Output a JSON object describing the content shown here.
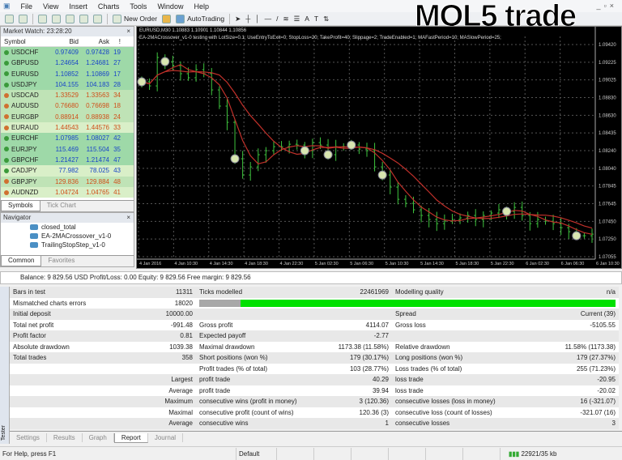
{
  "menu": [
    "File",
    "View",
    "Insert",
    "Charts",
    "Tools",
    "Window",
    "Help"
  ],
  "toolbar": {
    "new_order": "New Order",
    "autotrading": "AutoTrading"
  },
  "watermark": "MQL5 trade",
  "market_watch": {
    "title": "Market Watch: 23:28:20",
    "headers": [
      "Symbol",
      "Bid",
      "Ask",
      "!"
    ],
    "rows": [
      {
        "symbol": "USDCHF",
        "bid": "0.97409",
        "ask": "0.97428",
        "spread": "19",
        "dir": "up",
        "hl": true
      },
      {
        "symbol": "GBPUSD",
        "bid": "1.24654",
        "ask": "1.24681",
        "spread": "27",
        "dir": "up",
        "hl": true
      },
      {
        "symbol": "EURUSD",
        "bid": "1.10852",
        "ask": "1.10869",
        "spread": "17",
        "dir": "up",
        "hl": true
      },
      {
        "symbol": "USDJPY",
        "bid": "104.155",
        "ask": "104.183",
        "spread": "28",
        "dir": "up",
        "hl": true
      },
      {
        "symbol": "USDCAD",
        "bid": "1.33529",
        "ask": "1.33563",
        "spread": "34",
        "dir": "down",
        "hl": true
      },
      {
        "symbol": "AUDUSD",
        "bid": "0.76680",
        "ask": "0.76698",
        "spread": "18",
        "dir": "down",
        "hl": true
      },
      {
        "symbol": "EURGBP",
        "bid": "0.88914",
        "ask": "0.88938",
        "spread": "24",
        "dir": "down",
        "hl": true
      },
      {
        "symbol": "EURAUD",
        "bid": "1.44543",
        "ask": "1.44576",
        "spread": "33",
        "dir": "down",
        "hl": false
      },
      {
        "symbol": "EURCHF",
        "bid": "1.07985",
        "ask": "1.08027",
        "spread": "42",
        "dir": "up",
        "hl": true
      },
      {
        "symbol": "EURJPY",
        "bid": "115.469",
        "ask": "115.504",
        "spread": "35",
        "dir": "up",
        "hl": true
      },
      {
        "symbol": "GBPCHF",
        "bid": "1.21427",
        "ask": "1.21474",
        "spread": "47",
        "dir": "up",
        "hl": true
      },
      {
        "symbol": "CADJPY",
        "bid": "77.982",
        "ask": "78.025",
        "spread": "43",
        "dir": "up",
        "hl": false
      },
      {
        "symbol": "GBPJPY",
        "bid": "129.836",
        "ask": "129.884",
        "spread": "48",
        "dir": "down",
        "hl": true
      },
      {
        "symbol": "AUDNZD",
        "bid": "1.04724",
        "ask": "1.04765",
        "spread": "41",
        "dir": "down",
        "hl": false
      }
    ],
    "tabs": [
      "Symbols",
      "Tick Chart"
    ]
  },
  "navigator": {
    "title": "Navigator",
    "items": [
      "closed_total",
      "EA-2MACrossover_v1-0",
      "TrailingStopStep_v1-0"
    ],
    "tabs": [
      "Common",
      "Favorites"
    ]
  },
  "chart": {
    "header": "EURUSD,M30  1.10883 1.10901 1.10844 1.10856",
    "ea_line": "EA-2MACrossover_v1-0 testing with LotSize=0.1; UseEntryToExit=0; StopLoss=20; TakeProfit=40; Slippage=2; TradeEnabled=1; MAFastPeriod=10; MASlowPeriod=25;",
    "price_labels": [
      "1.09420",
      "1.09225",
      "1.09025",
      "1.08830",
      "1.08630",
      "1.08435",
      "1.08240",
      "1.08040",
      "1.07845",
      "1.07645",
      "1.07450",
      "1.07250",
      "1.07055"
    ],
    "time_labels": [
      "4 Jan 2016",
      "4 Jan 10:30",
      "4 Jan 14:30",
      "4 Jan 18:30",
      "4 Jan 22:30",
      "5 Jan 02:30",
      "5 Jan 06:30",
      "5 Jan 10:30",
      "5 Jan 14:30",
      "5 Jan 18:30",
      "5 Jan 22:30",
      "6 Jan 02:30",
      "6 Jan 06:30",
      "6 Jan 10:30"
    ],
    "price_range": [
      1.07055,
      1.0942
    ],
    "closes": [
      1.09005,
      1.08959,
      1.09276,
      1.0923,
      1.09185,
      1.09095,
      1.0905,
      1.0914,
      1.09095,
      1.08914,
      1.08734,
      1.08553,
      1.08147,
      1.07966,
      1.08056,
      1.08192,
      1.08237,
      1.08282,
      1.08282,
      1.08309,
      1.083,
      1.08237,
      1.08327,
      1.083,
      1.08192,
      1.08282,
      1.08282,
      1.083,
      1.08255,
      1.08237,
      1.08056,
      1.07966,
      1.07831,
      1.07695,
      1.0765,
      1.07578,
      1.07515,
      1.0747,
      1.07424,
      1.07451,
      1.0747,
      1.07488,
      1.07515,
      1.0747,
      1.07515,
      1.07542,
      1.07578,
      1.0756,
      1.07605,
      1.07515,
      1.07424,
      1.0747,
      1.07451,
      1.07424,
      1.07379,
      1.07334,
      1.07289,
      1.07289,
      1.07307
    ],
    "trade_marker_bars": [
      0,
      3,
      12,
      21,
      24,
      27,
      31,
      47,
      56
    ],
    "colors": {
      "bull": "#3ec43e",
      "ma": "#c0302a",
      "marker": "#d8e6b0"
    }
  },
  "balance": "Balance: 9 829.56 USD  Profit/Loss: 0.00  Equity: 9 829.56  Free margin: 9 829.56",
  "report": {
    "rows": [
      [
        "Bars in test",
        "11311",
        "Ticks modelled",
        "22461969",
        "Modelling quality",
        "n/a"
      ],
      [
        "Mismatched charts errors",
        "18020",
        "__bar__",
        "",
        "",
        ""
      ],
      [
        "Initial deposit",
        "10000.00",
        "",
        "",
        "Spread",
        "Current (39)"
      ],
      [
        "Total net profit",
        "-991.48",
        "Gross profit",
        "4114.07",
        "Gross loss",
        "-5105.55"
      ],
      [
        "Profit factor",
        "0.81",
        "Expected payoff",
        "-2.77",
        "",
        ""
      ],
      [
        "Absolute drawdown",
        "1039.38",
        "Maximal drawdown",
        "1173.38 (11.58%)",
        "Relative drawdown",
        "11.58% (1173.38)"
      ],
      [
        "Total trades",
        "358",
        "Short positions (won %)",
        "179 (30.17%)",
        "Long positions (won %)",
        "179 (27.37%)"
      ],
      [
        "",
        "",
        "Profit trades (% of total)",
        "103 (28.77%)",
        "Loss trades (% of total)",
        "255 (71.23%)"
      ],
      [
        "",
        "Largest",
        "profit trade",
        "40.29",
        "loss trade",
        "-20.95"
      ],
      [
        "",
        "Average",
        "profit trade",
        "39.94",
        "loss trade",
        "-20.02"
      ],
      [
        "",
        "Maximum",
        "consecutive wins (profit in money)",
        "3 (120.36)",
        "consecutive losses (loss in money)",
        "16 (-321.07)"
      ],
      [
        "",
        "Maximal",
        "consecutive profit (count of wins)",
        "120.36 (3)",
        "consecutive loss (count of losses)",
        "-321.07 (16)"
      ],
      [
        "",
        "Average",
        "consecutive wins",
        "1",
        "consecutive losses",
        "3"
      ]
    ],
    "modelling_quality_fraction": 0.9
  },
  "tester_tabs": [
    "Settings",
    "Results",
    "Graph",
    "Report",
    "Journal"
  ],
  "tester_label": "Tester",
  "status": {
    "help": "For Help, press F1",
    "profile": "Default",
    "traffic": "22921/35 kb"
  }
}
